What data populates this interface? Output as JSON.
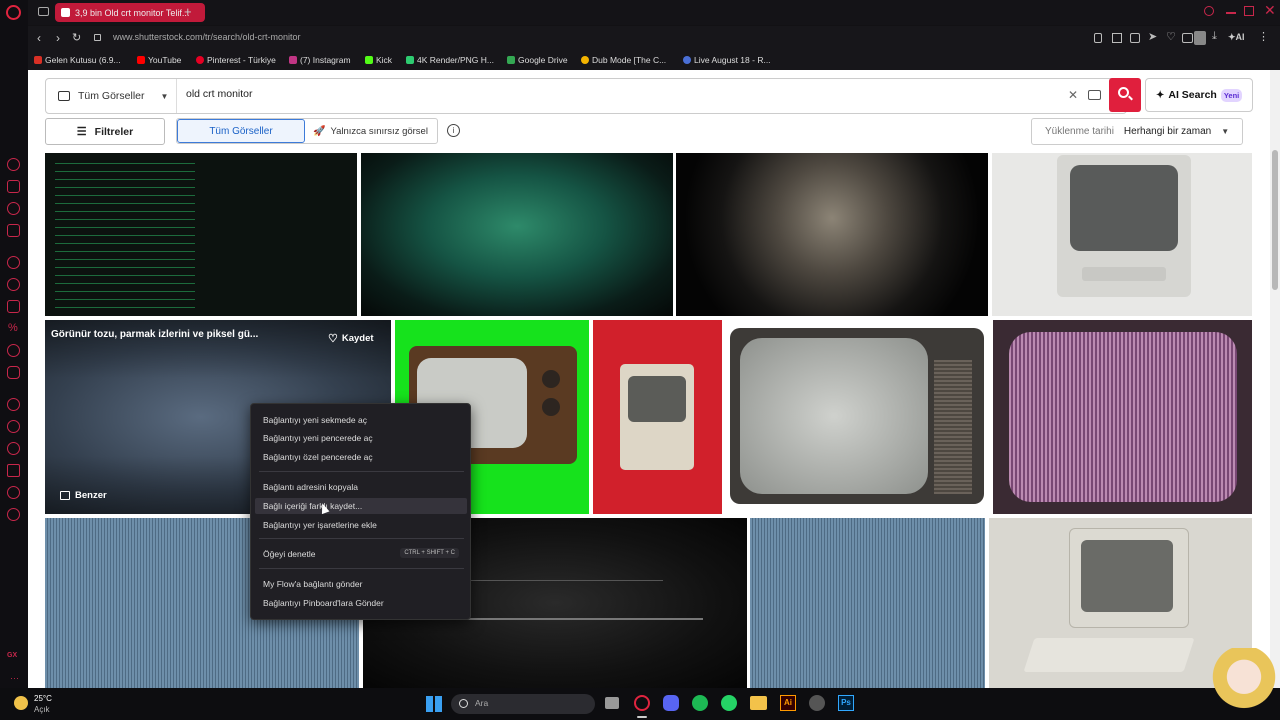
{
  "browser": {
    "tab_title": "3,9 bin Old crt monitor Telif...",
    "url": "www.shutterstock.com/tr/search/old-crt-monitor",
    "toolbar_ai": "AI"
  },
  "bookmarks": [
    {
      "label": "Gelen Kutusu (6.9...",
      "color": "#d93025"
    },
    {
      "label": "YouTube",
      "color": "#ff0000"
    },
    {
      "label": "Pinterest - Türkiye",
      "color": "#e60023"
    },
    {
      "label": "(7) Instagram",
      "color": "#c13584"
    },
    {
      "label": "Kick",
      "color": "#53fc18"
    },
    {
      "label": "4K Render/PNG H...",
      "color": "#2ecc71"
    },
    {
      "label": "Google Drive",
      "color": "#34a853"
    },
    {
      "label": "Dub Mode [The C...",
      "color": "#f4b400"
    },
    {
      "label": "Live August 18 - R...",
      "color": "#4a6fd6"
    }
  ],
  "search": {
    "type_label": "Tüm Görseller",
    "query": "old crt monitor",
    "ai_label": "AI Search",
    "ai_badge": "Yeni"
  },
  "filters": {
    "filters_label": "Filtreler",
    "all_images": "Tüm Görseller",
    "unlimited": "Yalnızca sınırsız görsel",
    "sort_label": "Yüklenme tarihi",
    "sort_value": "Herhangi bir zaman"
  },
  "hover_card": {
    "title": "Görünür tozu, parmak izlerini ve piksel gü...",
    "save": "Kaydet",
    "similar": "Benzer"
  },
  "context_menu": {
    "items": [
      "Bağlantıyı yeni sekmede aç",
      "Bağlantıyı yeni pencerede aç",
      "Bağlantıyı özel pencerede aç",
      "Bağlantı adresini kopyala",
      "Bağlı içeriği farklı kaydet...",
      "Bağlantıyı yer işaretlerine ekle",
      "Öğeyi denetle",
      "My Flow'a bağlantı gönder",
      "Bağlantıyı Pinboard'lara Gönder"
    ],
    "shortcut": "CTRL + SHIFT + C"
  },
  "taskbar": {
    "temp": "25°C",
    "weather": "Açık",
    "search_placeholder": "Ara"
  },
  "colors": {
    "accent": "#e01f3d",
    "opera_red": "#c11a3a",
    "link_blue": "#1b62c7"
  }
}
